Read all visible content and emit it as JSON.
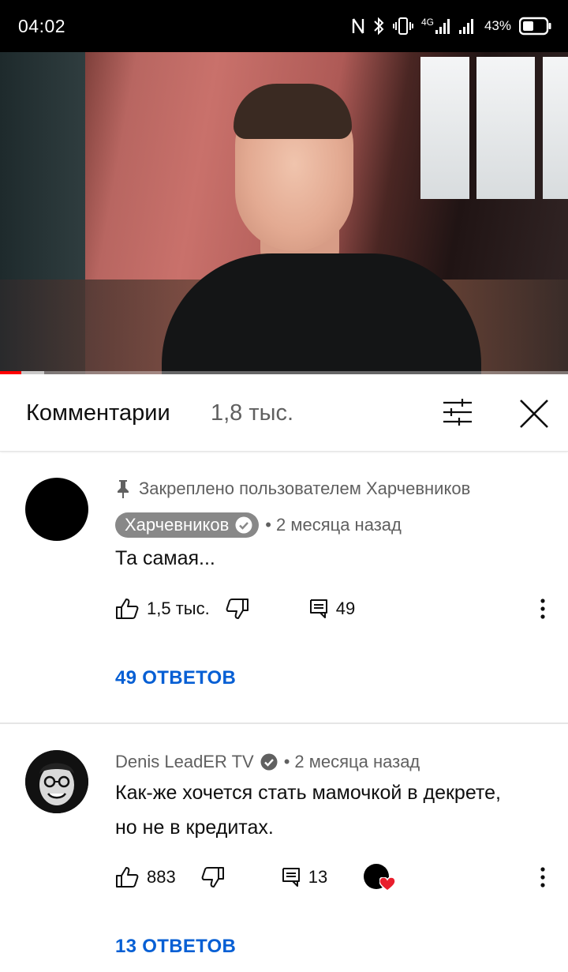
{
  "status_bar": {
    "time": "04:02",
    "network_label": "4G",
    "battery_percent": "43%",
    "icons": [
      "nfc-icon",
      "bluetooth-icon",
      "vibrate-icon",
      "signal-4g-icon",
      "signal-icon",
      "battery-icon"
    ]
  },
  "video": {
    "progress_played": 0.037,
    "progress_loaded": 0.078,
    "colors": {
      "progress": "#ff0000"
    }
  },
  "comments_panel": {
    "title": "Комментарии",
    "count": "1,8 тыс.",
    "icons": {
      "filter": "sort-filter-icon",
      "close": "close-icon"
    }
  },
  "comments": [
    {
      "pinned_label": "Закреплено пользователем Харчевников",
      "author": "Харчевников",
      "verified": true,
      "time": "2 месяца назад",
      "text": "Та самая...",
      "likes": "1,5 тыс.",
      "reply_count": "49",
      "replies_link": "49 ОТВЕТОВ"
    },
    {
      "author": "Denis LeadER TV",
      "verified": true,
      "time": "2 месяца назад",
      "text": "Как-же хочется стать мамочкой в декрете, но не в кредитах.",
      "likes": "883",
      "reply_count": "13",
      "creator_hearted": true,
      "replies_link": "13 ОТВЕТОВ"
    }
  ],
  "colors": {
    "link_blue": "#065fd4",
    "secondary_text": "#606060",
    "author_chip": "#888888",
    "heart_red": "#e91e2c"
  },
  "separator": "•"
}
